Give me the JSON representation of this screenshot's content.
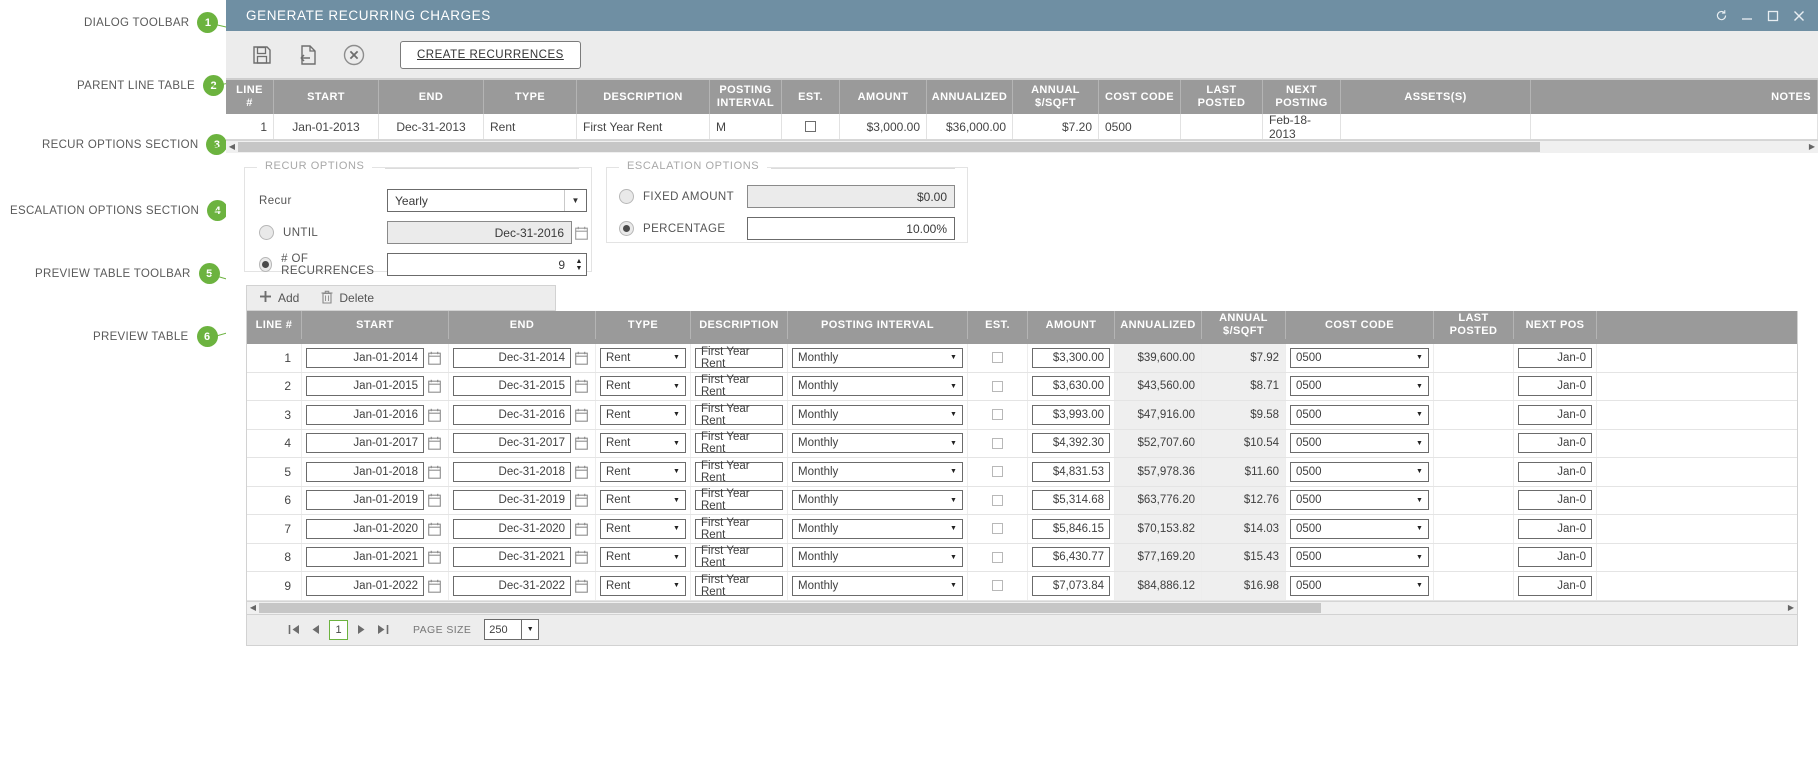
{
  "annotations": [
    {
      "n": "1",
      "label": "DIALOG TOOLBAR"
    },
    {
      "n": "2",
      "label": "PARENT LINE TABLE"
    },
    {
      "n": "3",
      "label": "RECUR OPTIONS SECTION"
    },
    {
      "n": "4",
      "label": "ESCALATION OPTIONS SECTION"
    },
    {
      "n": "5",
      "label": "PREVIEW TABLE TOOLBAR"
    },
    {
      "n": "6",
      "label": "PREVIEW TABLE"
    }
  ],
  "window": {
    "title": "GENERATE RECURRING CHARGES",
    "refresh_icon": "refresh-icon",
    "minimize_icon": "minimize-icon",
    "maximize_icon": "maximize-icon",
    "close_icon": "close-icon",
    "accent_color": "#6f8fa3"
  },
  "toolbar": {
    "save_icon": "save-icon",
    "export_icon": "export-icon",
    "cancel_icon": "cancel-circle-icon",
    "create_recurrences_label": "CREATE RECURRENCES"
  },
  "parent_table": {
    "columns": [
      "LINE #",
      "START",
      "END",
      "TYPE",
      "DESCRIPTION",
      "POSTING INTERVAL",
      "EST.",
      "AMOUNT",
      "ANNUALIZED",
      "ANNUAL $/SQFT",
      "COST CODE",
      "LAST POSTED",
      "NEXT POSTING",
      "ASSETS(S)",
      "NOTES"
    ],
    "rows": [
      {
        "line": "1",
        "start": "Jan-01-2013",
        "end": "Dec-31-2013",
        "type": "Rent",
        "description": "First Year Rent",
        "posting_interval": "M",
        "est": false,
        "amount": "$3,000.00",
        "annualized": "$36,000.00",
        "annual_sqft": "$7.20",
        "cost_code": "0500",
        "last_posted": "",
        "next_posting": "Feb-18-2013",
        "assets": "",
        "notes": ""
      }
    ]
  },
  "recur_options": {
    "legend": "RECUR OPTIONS",
    "recur_label": "Recur",
    "recur_value": "Yearly",
    "until_label": "UNTIL",
    "until_selected": false,
    "until_value": "Dec-31-2016",
    "recurrences_label": "# OF RECURRENCES",
    "recurrences_selected": true,
    "recurrences_value": "9"
  },
  "escalation_options": {
    "legend": "ESCALATION OPTIONS",
    "fixed_label": "FIXED AMOUNT",
    "fixed_selected": false,
    "fixed_value": "$0.00",
    "percentage_label": "PERCENTAGE",
    "percentage_selected": true,
    "percentage_value": "10.00%"
  },
  "preview_toolbar": {
    "add_label": "Add",
    "add_icon": "plus-icon",
    "delete_label": "Delete",
    "delete_icon": "trash-icon"
  },
  "preview_table": {
    "columns": [
      "LINE #",
      "START",
      "END",
      "TYPE",
      "DESCRIPTION",
      "POSTING INTERVAL",
      "EST.",
      "AMOUNT",
      "ANNUALIZED",
      "ANNUAL $/SQFT",
      "COST CODE",
      "LAST POSTED",
      "NEXT POS"
    ],
    "rows": [
      {
        "line": "1",
        "start": "Jan-01-2014",
        "end": "Dec-31-2014",
        "type": "Rent",
        "description": "First Year Rent",
        "posting_interval": "Monthly",
        "est": false,
        "amount": "$3,300.00",
        "annualized": "$39,600.00",
        "annual_sqft": "$7.92",
        "cost_code": "0500",
        "last_posted": "",
        "next_posting": "Jan-0"
      },
      {
        "line": "2",
        "start": "Jan-01-2015",
        "end": "Dec-31-2015",
        "type": "Rent",
        "description": "First Year Rent",
        "posting_interval": "Monthly",
        "est": false,
        "amount": "$3,630.00",
        "annualized": "$43,560.00",
        "annual_sqft": "$8.71",
        "cost_code": "0500",
        "last_posted": "",
        "next_posting": "Jan-0"
      },
      {
        "line": "3",
        "start": "Jan-01-2016",
        "end": "Dec-31-2016",
        "type": "Rent",
        "description": "First Year Rent",
        "posting_interval": "Monthly",
        "est": false,
        "amount": "$3,993.00",
        "annualized": "$47,916.00",
        "annual_sqft": "$9.58",
        "cost_code": "0500",
        "last_posted": "",
        "next_posting": "Jan-0"
      },
      {
        "line": "4",
        "start": "Jan-01-2017",
        "end": "Dec-31-2017",
        "type": "Rent",
        "description": "First Year Rent",
        "posting_interval": "Monthly",
        "est": false,
        "amount": "$4,392.30",
        "annualized": "$52,707.60",
        "annual_sqft": "$10.54",
        "cost_code": "0500",
        "last_posted": "",
        "next_posting": "Jan-0"
      },
      {
        "line": "5",
        "start": "Jan-01-2018",
        "end": "Dec-31-2018",
        "type": "Rent",
        "description": "First Year Rent",
        "posting_interval": "Monthly",
        "est": false,
        "amount": "$4,831.53",
        "annualized": "$57,978.36",
        "annual_sqft": "$11.60",
        "cost_code": "0500",
        "last_posted": "",
        "next_posting": "Jan-0"
      },
      {
        "line": "6",
        "start": "Jan-01-2019",
        "end": "Dec-31-2019",
        "type": "Rent",
        "description": "First Year Rent",
        "posting_interval": "Monthly",
        "est": false,
        "amount": "$5,314.68",
        "annualized": "$63,776.20",
        "annual_sqft": "$12.76",
        "cost_code": "0500",
        "last_posted": "",
        "next_posting": "Jan-0"
      },
      {
        "line": "7",
        "start": "Jan-01-2020",
        "end": "Dec-31-2020",
        "type": "Rent",
        "description": "First Year Rent",
        "posting_interval": "Monthly",
        "est": false,
        "amount": "$5,846.15",
        "annualized": "$70,153.82",
        "annual_sqft": "$14.03",
        "cost_code": "0500",
        "last_posted": "",
        "next_posting": "Jan-0"
      },
      {
        "line": "8",
        "start": "Jan-01-2021",
        "end": "Dec-31-2021",
        "type": "Rent",
        "description": "First Year Rent",
        "posting_interval": "Monthly",
        "est": false,
        "amount": "$6,430.77",
        "annualized": "$77,169.20",
        "annual_sqft": "$15.43",
        "cost_code": "0500",
        "last_posted": "",
        "next_posting": "Jan-0"
      },
      {
        "line": "9",
        "start": "Jan-01-2022",
        "end": "Dec-31-2022",
        "type": "Rent",
        "description": "First Year Rent",
        "posting_interval": "Monthly",
        "est": false,
        "amount": "$7,073.84",
        "annualized": "$84,886.12",
        "annual_sqft": "$16.98",
        "cost_code": "0500",
        "last_posted": "",
        "next_posting": "Jan-0"
      }
    ]
  },
  "pager": {
    "first_icon": "first-page-icon",
    "prev_icon": "prev-page-icon",
    "page_number": "1",
    "next_icon": "next-page-icon",
    "last_icon": "last-page-icon",
    "page_size_label": "PAGE SIZE",
    "page_size_value": "250"
  }
}
